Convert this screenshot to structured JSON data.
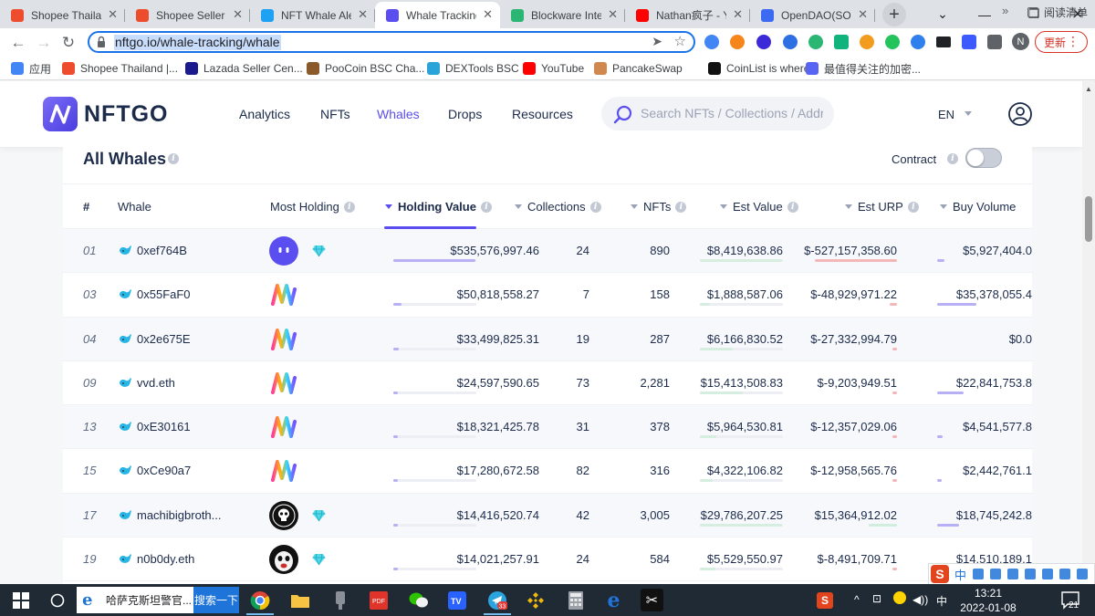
{
  "browser": {
    "tabs": [
      {
        "title": "Shopee Thailand",
        "favicon_color": "#ee4d2d",
        "active": false
      },
      {
        "title": "Shopee Seller Centre",
        "favicon_color": "#ee4d2d",
        "active": false
      },
      {
        "title": "NFT Whale Alert",
        "favicon_color": "#1da1f2",
        "active": false
      },
      {
        "title": "Whale Tracking",
        "favicon_color": "#5b4ef0",
        "active": true
      },
      {
        "title": "Blockware Intelligence",
        "favicon_color": "#2bb673",
        "active": false
      },
      {
        "title": "Nathan疯子 - YouTube",
        "favicon_color": "#ff0000",
        "active": false
      },
      {
        "title": "OpenDAO(SOS)",
        "favicon_color": "#3d6af2",
        "active": false
      }
    ],
    "url": "nftgo.io/whale-tracking/whale",
    "update_label": "更新",
    "profile_initial": "N",
    "bookmarks": [
      {
        "label": "应用",
        "color": "#4285f4"
      },
      {
        "label": "Shopee Thailand |...",
        "color": "#ee4d2d"
      },
      {
        "label": "Lazada Seller Cen...",
        "color": "#1a1a8c"
      },
      {
        "label": "PooCoin BSC Cha...",
        "color": "#8a5a2b"
      },
      {
        "label": "DEXTools BSC",
        "color": "#29a3d8"
      },
      {
        "label": "YouTube",
        "color": "#ff0000"
      },
      {
        "label": "PancakeSwap",
        "color": "#d1884f"
      },
      {
        "label": "CoinList is where...",
        "color": "#111111"
      },
      {
        "label": "最值得关注的加密...",
        "color": "#5865f2"
      }
    ],
    "reading_list_label": "阅读清单"
  },
  "site": {
    "logo_text": "NFTGO",
    "nav": [
      {
        "label": "Analytics",
        "active": false
      },
      {
        "label": "NFTs",
        "active": false
      },
      {
        "label": "Whales",
        "active": true
      },
      {
        "label": "Drops",
        "active": false
      },
      {
        "label": "Resources",
        "active": false
      }
    ],
    "search_placeholder": "Search NFTs / Collections / Address",
    "language": "EN",
    "accent_color": "#5b4ef0"
  },
  "whales": {
    "title": "All Whales",
    "contract_label": "Contract",
    "contract_enabled": false,
    "columns": [
      "#",
      "Whale",
      "Most Holding",
      "Holding Value",
      "Collections",
      "NFTs",
      "Est Value",
      "Est URP",
      "Buy Volume"
    ],
    "rows": [
      {
        "rank": "01",
        "whale": "0xef764B",
        "holding_icon": "purple-ghost-icon",
        "diamond": true,
        "holding_value": "$535,576,997.46",
        "collections": "24",
        "nfts": "890",
        "est_value": "$8,419,638.86",
        "est_urp": "$-527,157,358.60",
        "buy_volume": "$5,927,404.0",
        "hv_pct": 1.0,
        "ev_pct": 1.0,
        "urp_pct": 1.0,
        "bv_pct": 0.09
      },
      {
        "rank": "03",
        "whale": "0x55FaF0",
        "holding_icon": "rainbow-wave-icon",
        "diamond": false,
        "holding_value": "$50,818,558.27",
        "collections": "7",
        "nfts": "158",
        "est_value": "$1,888,587.06",
        "est_urp": "$-48,929,971.22",
        "buy_volume": "$35,378,055.4",
        "hv_pct": 0.1,
        "ev_pct": 0.12,
        "urp_pct": 0.09,
        "bv_pct": 0.48
      },
      {
        "rank": "04",
        "whale": "0x2e675E",
        "holding_icon": "rainbow-wave-icon",
        "diamond": false,
        "holding_value": "$33,499,825.31",
        "collections": "19",
        "nfts": "287",
        "est_value": "$6,166,830.52",
        "est_urp": "$-27,332,994.79",
        "buy_volume": "$0.0",
        "hv_pct": 0.07,
        "ev_pct": 0.4,
        "urp_pct": 0.06,
        "bv_pct": 0.0
      },
      {
        "rank": "09",
        "whale": "vvd.eth",
        "holding_icon": "rainbow-wave-icon",
        "diamond": false,
        "holding_value": "$24,597,590.65",
        "collections": "73",
        "nfts": "2,281",
        "est_value": "$15,413,508.83",
        "est_urp": "$-9,203,949.51",
        "buy_volume": "$22,841,753.8",
        "hv_pct": 0.05,
        "ev_pct": 0.52,
        "urp_pct": 0.02,
        "bv_pct": 0.32
      },
      {
        "rank": "13",
        "whale": "0xE30161",
        "holding_icon": "rainbow-wave-icon",
        "diamond": false,
        "holding_value": "$18,321,425.78",
        "collections": "31",
        "nfts": "378",
        "est_value": "$5,964,530.81",
        "est_urp": "$-12,357,029.06",
        "buy_volume": "$4,541,577.8",
        "hv_pct": 0.04,
        "ev_pct": 0.2,
        "urp_pct": 0.03,
        "bv_pct": 0.07
      },
      {
        "rank": "15",
        "whale": "0xCe90a7",
        "holding_icon": "rainbow-wave-icon",
        "diamond": false,
        "holding_value": "$17,280,672.58",
        "collections": "82",
        "nfts": "316",
        "est_value": "$4,322,106.82",
        "est_urp": "$-12,958,565.76",
        "buy_volume": "$2,442,761.1",
        "hv_pct": 0.04,
        "ev_pct": 0.15,
        "urp_pct": 0.03,
        "bv_pct": 0.04
      },
      {
        "rank": "17",
        "whale": "machibigbroth...",
        "holding_icon": "skull-badge-icon",
        "diamond": true,
        "holding_value": "$14,416,520.74",
        "collections": "42",
        "nfts": "3,005",
        "est_value": "$29,786,207.25",
        "est_urp": "$15,364,912.02",
        "buy_volume": "$18,745,242.8",
        "hv_pct": 0.03,
        "ev_pct": 1.0,
        "urp_pct": 0.35,
        "bv_pct": 0.27
      },
      {
        "rank": "19",
        "whale": "n0b0dy.eth",
        "holding_icon": "ape-face-icon",
        "diamond": true,
        "holding_value": "$14,021,257.91",
        "collections": "24",
        "nfts": "584",
        "est_value": "$5,529,550.97",
        "est_urp": "$-8,491,709.71",
        "buy_volume": "$14,510,189.1",
        "hv_pct": 0.03,
        "ev_pct": 0.19,
        "urp_pct": 0.02,
        "bv_pct": 0.2
      }
    ]
  },
  "taskbar": {
    "search_text": "哈萨克斯坦警官...",
    "search_button": "搜索一下",
    "badge": "33",
    "ime_lang": "中",
    "tray_lang": "中",
    "time": "13:21",
    "date": "2022-01-08",
    "notifications": "21"
  }
}
